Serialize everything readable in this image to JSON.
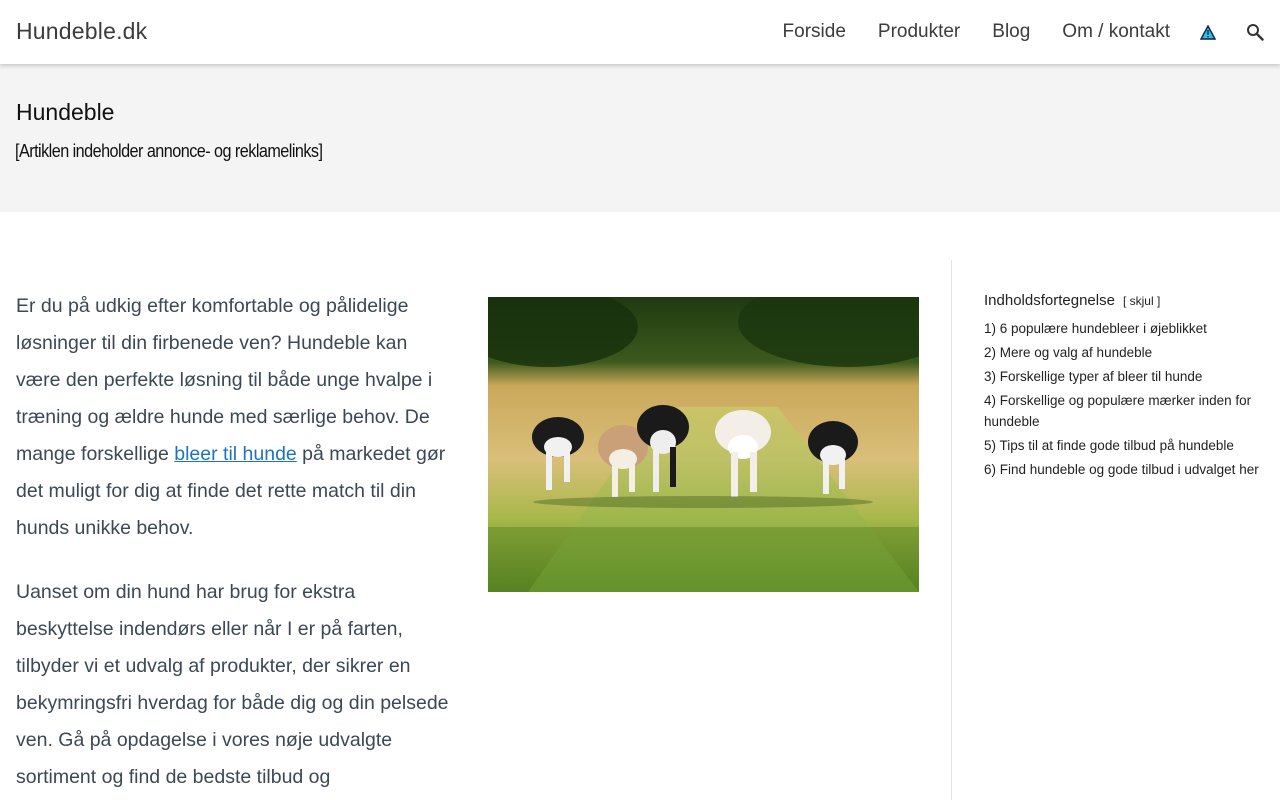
{
  "header": {
    "site_title": "Hundeble.dk",
    "nav": [
      {
        "label": "Forside"
      },
      {
        "label": "Produkter"
      },
      {
        "label": "Blog"
      },
      {
        "label": "Om / kontakt"
      }
    ],
    "icons": {
      "accessibility": "warning-triangle-icon",
      "search": "search-icon"
    }
  },
  "band": {
    "title": "Hundeble",
    "disclaimer": "[Artiklen indeholder annonce- og reklamelinks]"
  },
  "article": {
    "p1_before": "Er du på udkig efter komfortable og pålidelige løsninger til din firbenede ven? Hundeble kan være den perfekte løsning til både unge hvalpe i træning og ældre hunde med særlige behov. De mange forskellige ",
    "p1_link": "bleer til hunde",
    "p1_after": " på markedet gør det muligt for dig at finde det rette match til din hunds unikke behov.",
    "p2": "Uanset om din hund har brug for ekstra beskyttelse indendørs eller når I er på farten, tilbyder vi et udvalg af produkter, der sikrer en bekymringsfri hverdag for både dig og din pelsede ven. Gå på opdagelse i vores nøje udvalgte sortiment og find de bedste tilbud og"
  },
  "toc": {
    "title": "Indholdsfortegnelse",
    "toggle": "[ skjul ]",
    "items": [
      {
        "label": "1) 6 populære hundebleer i øjeblikket"
      },
      {
        "label": "2) Mere og valg af hundeble"
      },
      {
        "label": "3) Forskellige typer af bleer til hunde"
      },
      {
        "label": "4) Forskellige og populære mærker inden for hundeble"
      },
      {
        "label": "5) Tips til at finde gode tilbud på hundeble"
      },
      {
        "label": "6) Find hundeble og gode tilbud i udvalget her"
      }
    ]
  },
  "colors": {
    "link": "#1e73be",
    "text": "#3b4856",
    "band_bg": "#f4f4f4"
  }
}
